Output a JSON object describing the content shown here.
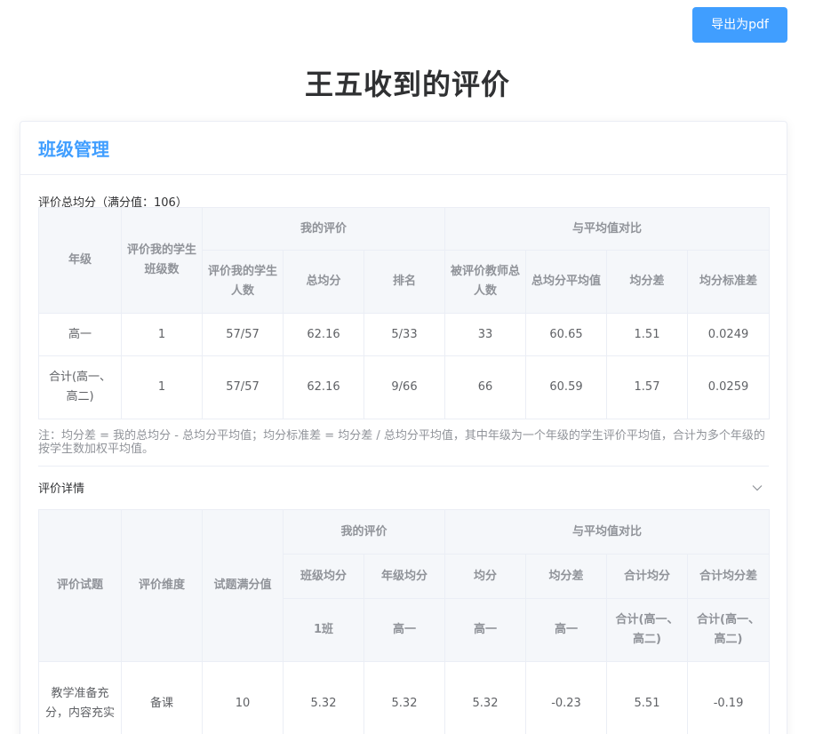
{
  "header": {
    "export_label": "导出为pdf",
    "title": "王五收到的评价"
  },
  "card": {
    "title": "班级管理"
  },
  "summary": {
    "label": "评价总均分（满分值：106）",
    "headers": {
      "grade": "年级",
      "class_count": "评价我的学生班级数",
      "my_eval": "我的评价",
      "compare": "与平均值对比",
      "student_count": "评价我的学生人数",
      "total_avg": "总均分",
      "rank": "排名",
      "teacher_count": "被评价教师总人数",
      "avg_of_total": "总均分平均值",
      "diff": "均分差",
      "std_diff": "均分标准差"
    },
    "rows": [
      [
        "高一",
        "1",
        "57/57",
        "62.16",
        "5/33",
        "33",
        "60.65",
        "1.51",
        "0.0249"
      ],
      [
        "合计(高一、高二)",
        "1",
        "57/57",
        "62.16",
        "9/66",
        "66",
        "60.59",
        "1.57",
        "0.0259"
      ]
    ],
    "note": "注：均分差 = 我的总均分 - 总均分平均值；均分标准差 = 均分差 / 总均分平均值，其中年级为一个年级的学生评价平均值，合计为多个年级的按学生数加权平均值。"
  },
  "details": {
    "label": "评价详情",
    "headers": {
      "item": "评价试题",
      "dimension": "评价维度",
      "full_score": "试题满分值",
      "my_eval": "我的评价",
      "compare": "与平均值对比",
      "class_avg": "班级均分",
      "grade_avg": "年级均分",
      "avg": "均分",
      "diff": "均分差",
      "total_avg": "合计均分",
      "total_diff": "合计均分差",
      "sub": [
        "1班",
        "高一",
        "高一",
        "高一",
        "合计(高一、高二)",
        "合计(高一、高二)"
      ]
    },
    "rows": [
      [
        "教学准备充分，内容充实",
        "备课",
        "10",
        "5.32",
        "5.32",
        "5.32",
        "-0.23",
        "5.51",
        "-0.19"
      ]
    ]
  }
}
